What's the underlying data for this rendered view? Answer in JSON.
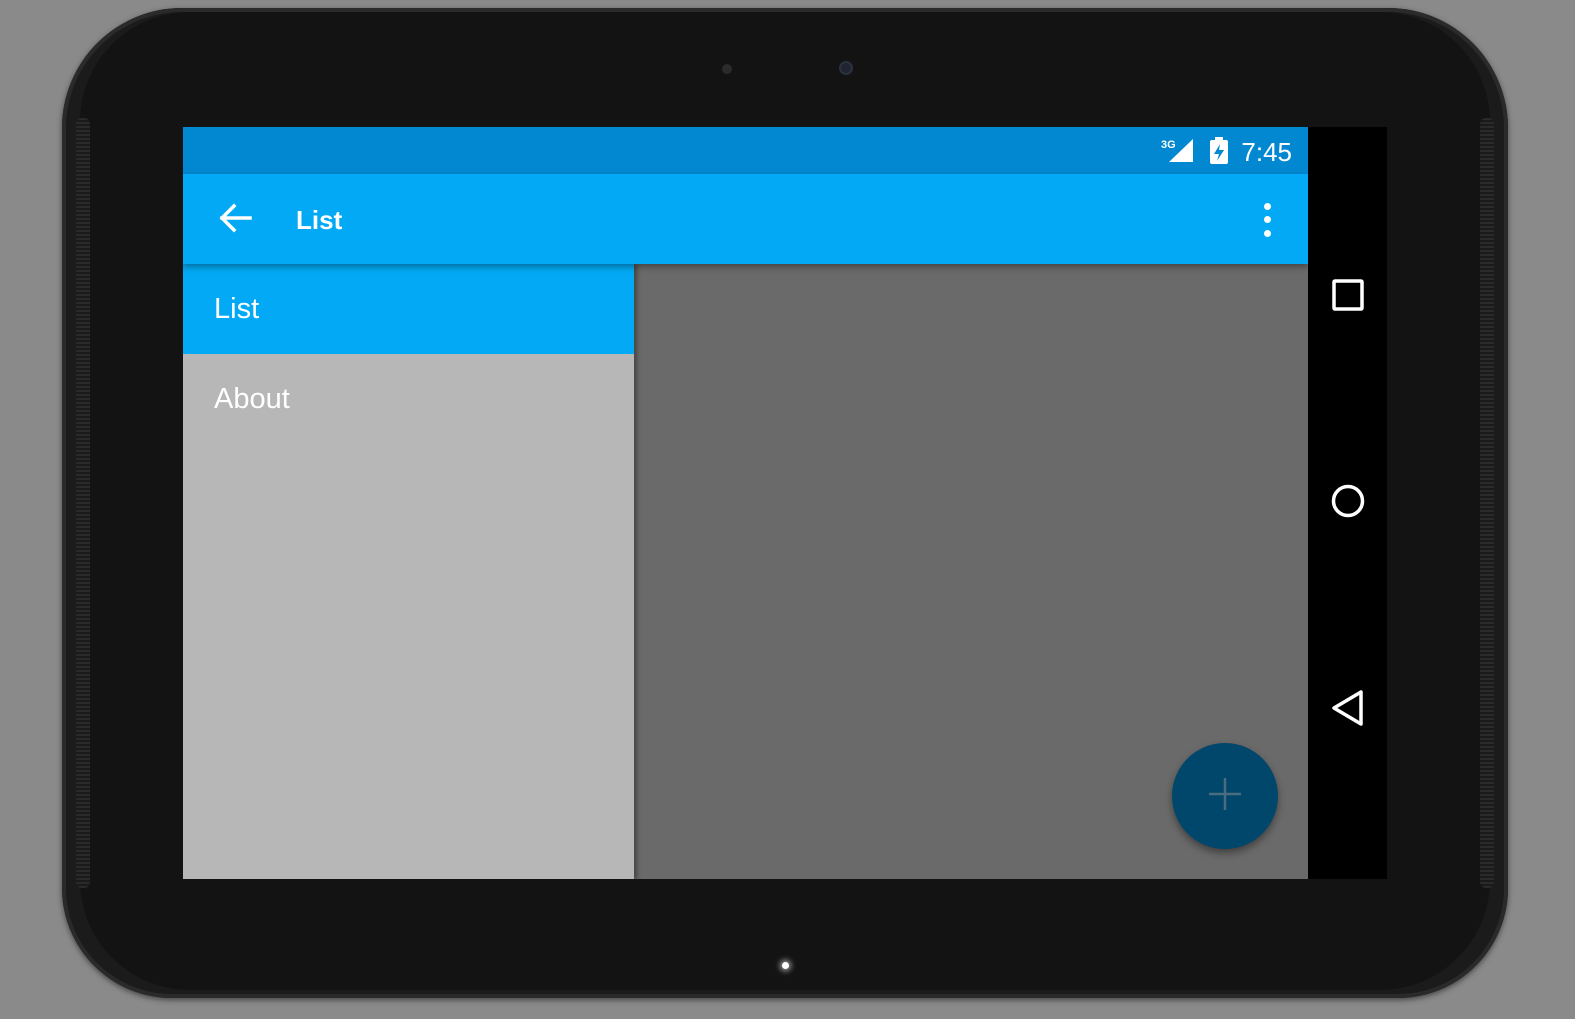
{
  "status_bar": {
    "time": "7:45",
    "network_label": "3G",
    "signal_icon": "signal-3g-icon",
    "battery_icon": "battery-charging-icon"
  },
  "toolbar": {
    "title": "List",
    "back_icon": "arrow-back-icon",
    "overflow_icon": "more-vert-icon"
  },
  "drawer": {
    "items": [
      {
        "label": "List",
        "active": true
      },
      {
        "label": "About",
        "active": false
      }
    ]
  },
  "fab": {
    "icon": "plus-icon"
  },
  "navigation_bar": {
    "buttons": [
      "recents-icon",
      "home-icon",
      "back-icon"
    ]
  },
  "colors": {
    "status_bar": "#0288d1",
    "toolbar": "#03a9f4",
    "drawer_active": "#03a9f4",
    "drawer_bg": "#b7b7b7",
    "content_bg": "#6a6a6a",
    "fab": "#01466b"
  }
}
